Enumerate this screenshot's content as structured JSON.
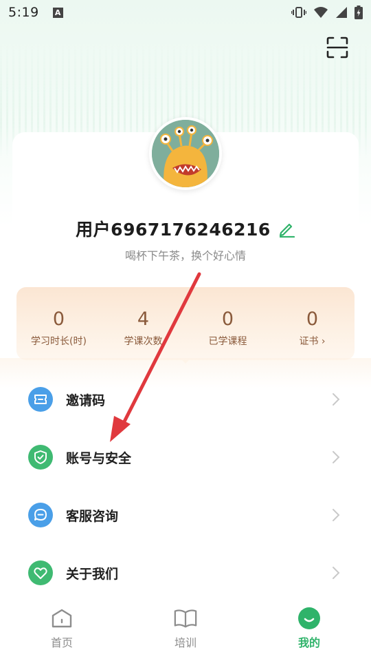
{
  "status_bar": {
    "time": "5:19",
    "indicator": "A",
    "icons": [
      "vibrate-icon",
      "wifi-icon",
      "signal-icon",
      "battery-icon"
    ]
  },
  "header": {
    "scan_icon": "scan-icon"
  },
  "profile": {
    "username": "用户6967176246216",
    "signature": "喝杯下午茶，换个好心情",
    "avatar": "monster-avatar"
  },
  "stats": [
    {
      "value": "0",
      "label": "学习时长(时)"
    },
    {
      "value": "4",
      "label": "学课次数"
    },
    {
      "value": "0",
      "label": "已学课程"
    },
    {
      "value": "0",
      "label": "证书 ›"
    }
  ],
  "menu": [
    {
      "label": "邀请码",
      "icon": "ticket-icon",
      "color": "#4a9fe8"
    },
    {
      "label": "账号与安全",
      "icon": "shield-icon",
      "color": "#3fba72"
    },
    {
      "label": "客服咨询",
      "icon": "chat-icon",
      "color": "#4a9fe8"
    },
    {
      "label": "关于我们",
      "icon": "heart-icon",
      "color": "#3fba72"
    }
  ],
  "tabs": [
    {
      "label": "首页",
      "icon": "home-icon",
      "active": false
    },
    {
      "label": "培训",
      "icon": "book-icon",
      "active": false
    },
    {
      "label": "我的",
      "icon": "smile-icon",
      "active": true
    }
  ],
  "colors": {
    "accent": "#2fb36a",
    "stat_text": "#8a5a3b",
    "annotation_arrow": "#e0393e"
  }
}
